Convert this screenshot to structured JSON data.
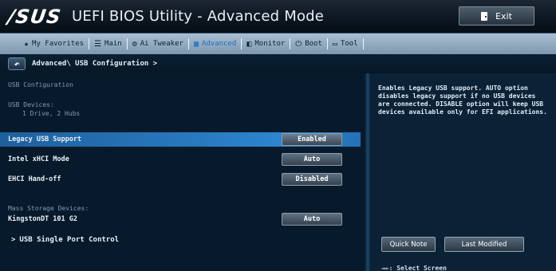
{
  "header": {
    "logo": "/SUS",
    "title": "UEFI BIOS Utility - Advanced Mode",
    "exit_label": "Exit"
  },
  "menu": {
    "items": [
      {
        "label": "My Favorites",
        "icon": "star-icon"
      },
      {
        "label": "Main",
        "icon": "list-icon"
      },
      {
        "label": "Ai Tweaker",
        "icon": "tweaker-icon"
      },
      {
        "label": "Advanced",
        "icon": "advanced-icon",
        "active": true
      },
      {
        "label": "Monitor",
        "icon": "monitor-icon"
      },
      {
        "label": "Boot",
        "icon": "power-icon"
      },
      {
        "label": "Tool",
        "icon": "tool-icon"
      }
    ],
    "active_color": "#1a6fc4"
  },
  "breadcrumb": {
    "text": "Advanced\\ USB Configuration >"
  },
  "main": {
    "usb_configuration_label": "USB Configuration",
    "usb_devices_label": "USB Devices:",
    "usb_devices_value": "1 Drive, 2 Hubs",
    "settings": [
      {
        "label": "Legacy USB Support",
        "value": "Enabled",
        "selected": true
      },
      {
        "label": "Intel xHCI Mode",
        "value": "Auto",
        "selected": false
      },
      {
        "label": "EHCI Hand-off",
        "value": "Disabled",
        "selected": false
      }
    ],
    "mass_storage_label": "Mass Storage Devices:",
    "mass_storage_device": {
      "label": "KingstonDT 101 G2",
      "value": "Auto"
    },
    "usb_single_port_label": "USB Single Port Control"
  },
  "help": {
    "text": "Enables Legacy USB support. AUTO option disables legacy support if no USB devices are connected. DISABLE option will keep USB devices available only for EFI applications.",
    "quick_note_label": "Quick Note",
    "last_modified_label": "Last Modified",
    "key_hint": "→←: Select Screen"
  },
  "colors": {
    "accent": "#2d86cf",
    "background": "#071a2c"
  }
}
